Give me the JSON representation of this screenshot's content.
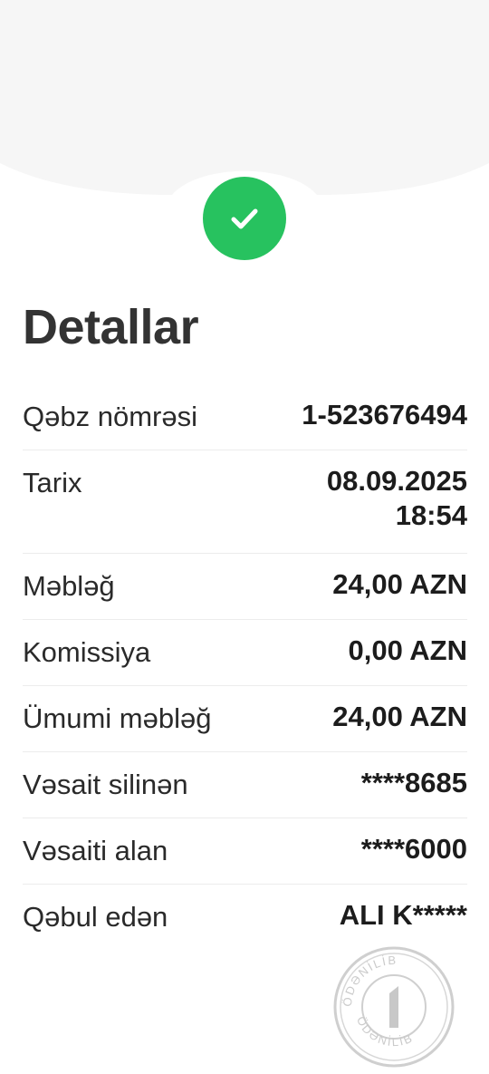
{
  "header": {
    "status_icon": "checkmark-icon",
    "status_color": "#27c25f",
    "background_color": "#f6f6f6"
  },
  "title": "Detallar",
  "details": [
    {
      "label": "Qəbz nömrəsi",
      "value": "1-523676494"
    },
    {
      "label": "Tarix",
      "value_line1": "08.09.2025",
      "value_line2": "18:54"
    },
    {
      "label": "Məbləğ",
      "value": "24,00 AZN"
    },
    {
      "label": "Komissiya",
      "value": "0,00 AZN"
    },
    {
      "label": "Ümumi məbləğ",
      "value": "24,00 AZN"
    },
    {
      "label": "Vəsait silinən",
      "value": "****8685"
    },
    {
      "label": "Vəsaiti alan",
      "value": "****6000"
    },
    {
      "label": "Qəbul edən",
      "value": "ALI K*****"
    }
  ],
  "stamp": {
    "text_top": "ÖDƏNİLİB",
    "text_bottom": "ÖDƏNİLİB",
    "text_right": "ÖDƏNİLİB"
  }
}
